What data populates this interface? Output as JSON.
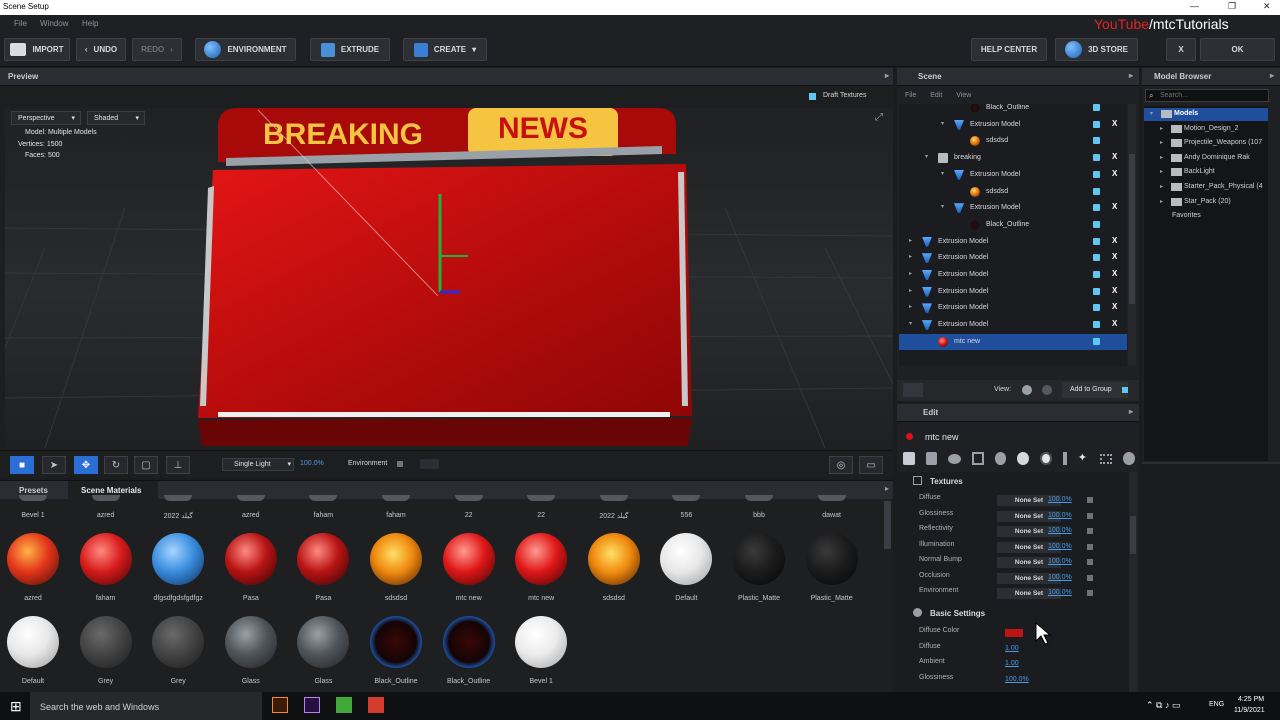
{
  "window": {
    "title": "Scene Setup"
  },
  "menu": [
    "File",
    "Window",
    "Help"
  ],
  "watermark": {
    "brand": "YouTube",
    "suffix": "/mtcTutorials"
  },
  "toolbar": {
    "import": "IMPORT",
    "undo": "UNDO",
    "redo": "REDO",
    "environment": "ENVIRONMENT",
    "extrude": "EXTRUDE",
    "create": "CREATE",
    "help_center": "HELP CENTER",
    "store": "3D STORE",
    "close": "X",
    "ok": "OK"
  },
  "preview": {
    "title": "Preview",
    "draft_textures": "Draft Textures",
    "projection": "Perspective",
    "shading": "Shaded",
    "model_label": "Model:",
    "model_value": "Multiple Models",
    "vertices_label": "Vertices:",
    "vertices_value": "1500",
    "faces_label": "Faces:",
    "faces_value": "500",
    "sign_left": "BREAKING",
    "sign_right": "NEWS",
    "light": "Single Light",
    "zoom": "100.0%",
    "environment_label": "Environment"
  },
  "materials": {
    "tabs": [
      "Presets",
      "Scene Materials"
    ],
    "row0": [
      "Bevel 1",
      "azred",
      "2022 گيلد",
      "azred",
      "faham",
      "faham",
      "22",
      "22",
      "2022 گيلد",
      "556",
      "bbb",
      "dawat"
    ],
    "row1": [
      "azred",
      "faham",
      "dfgsdfgdsfgdfgz",
      "Pasa",
      "Pasa",
      "sdsdsd",
      "mtc new",
      "mtc new",
      "sdsdsd",
      "Default",
      "Plastic_Matte",
      "Plastic_Matte"
    ],
    "row2": [
      "Default",
      "Grey",
      "Grey",
      "Glass",
      "Glass",
      "Black_Outline",
      "Black_Outline",
      "Bevel 1"
    ]
  },
  "scene": {
    "title": "Scene",
    "menu": [
      "File",
      "Edit",
      "View"
    ],
    "rows": [
      {
        "label": "Black_Outline",
        "level": 4,
        "icon": "material-dark",
        "x": false
      },
      {
        "label": "Extrusion Model",
        "level": 3,
        "icon": "model",
        "x": true
      },
      {
        "label": "sdsdsd",
        "level": 4,
        "icon": "material-orange",
        "x": false
      },
      {
        "label": "breaking",
        "level": 2,
        "icon": "folder",
        "x": true
      },
      {
        "label": "Extrusion Model",
        "level": 3,
        "icon": "model",
        "x": true
      },
      {
        "label": "sdsdsd",
        "level": 4,
        "icon": "material-orange",
        "x": false
      },
      {
        "label": "Extrusion Model",
        "level": 3,
        "icon": "model",
        "x": true
      },
      {
        "label": "Black_Outline",
        "level": 4,
        "icon": "material-dark",
        "x": false
      },
      {
        "label": "Extrusion Model",
        "level": 1,
        "icon": "model",
        "x": true
      },
      {
        "label": "Extrusion Model",
        "level": 1,
        "icon": "model",
        "x": true
      },
      {
        "label": "Extrusion Model",
        "level": 1,
        "icon": "model",
        "x": true
      },
      {
        "label": "Extrusion Model",
        "level": 1,
        "icon": "model",
        "x": true
      },
      {
        "label": "Extrusion Model",
        "level": 1,
        "icon": "model",
        "x": true
      },
      {
        "label": "Extrusion Model",
        "level": 1,
        "icon": "model",
        "x": true
      },
      {
        "label": "mtc new",
        "level": 2,
        "icon": "material-red",
        "x": false
      }
    ],
    "view_label": "View:",
    "add_to_group": "Add to Group"
  },
  "edit": {
    "title": "Edit",
    "object": "mtc new",
    "textures_title": "Textures",
    "textures": [
      {
        "name": "Diffuse",
        "value": "None Set",
        "pct": "100.0%"
      },
      {
        "name": "Glossiness",
        "value": "None Set",
        "pct": "100.0%"
      },
      {
        "name": "Reflectivity",
        "value": "None Set",
        "pct": "100.0%"
      },
      {
        "name": "Illumination",
        "value": "None Set",
        "pct": "100.0%"
      },
      {
        "name": "Normal Bump",
        "value": "None Set",
        "pct": "100.0%"
      },
      {
        "name": "Occlusion",
        "value": "None Set",
        "pct": "100.0%"
      },
      {
        "name": "Environment",
        "value": "None Set",
        "pct": "100.0%"
      }
    ],
    "basic_title": "Basic Settings",
    "basic": [
      {
        "name": "Diffuse Color",
        "value": ""
      },
      {
        "name": "Diffuse",
        "value": "1.00"
      },
      {
        "name": "Ambient",
        "value": "1.00"
      },
      {
        "name": "Glossiness",
        "value": "100.0%"
      }
    ],
    "diffuse_color": "#c01414"
  },
  "model_browser": {
    "title": "Model Browser",
    "search_placeholder": "Search...",
    "items": [
      {
        "label": "Models",
        "level": 0
      },
      {
        "label": "Motion_Design_2",
        "level": 1
      },
      {
        "label": "Projectile_Weapons (107",
        "level": 1
      },
      {
        "label": "Andy Dominique Rak",
        "level": 1
      },
      {
        "label": "BackLight",
        "level": 1
      },
      {
        "label": "Starter_Pack_Physical (4",
        "level": 1
      },
      {
        "label": "Star_Pack (20)",
        "level": 1
      },
      {
        "label": "Favorites",
        "level": 0
      }
    ]
  },
  "taskbar": {
    "search": "Search the web and Windows",
    "lang": "ENG",
    "time": "4:25 PM",
    "date": "11/9/2021"
  },
  "colors": {
    "accent": "#1f4f9c",
    "red": "#c01414",
    "gold": "#f5c542"
  }
}
